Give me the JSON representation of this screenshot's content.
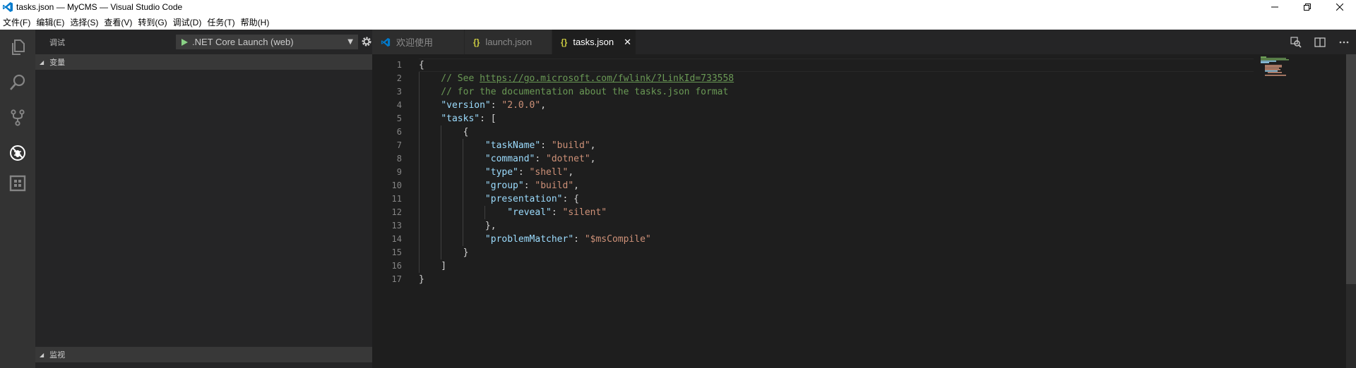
{
  "window": {
    "title": "tasks.json — MyCMS — Visual Studio Code"
  },
  "menu": [
    "文件(F)",
    "编辑(E)",
    "选择(S)",
    "查看(V)",
    "转到(G)",
    "调试(D)",
    "任务(T)",
    "帮助(H)"
  ],
  "sidebar": {
    "title": "调试",
    "launch_config": ".NET Core Launch (web)",
    "sections": {
      "variables": "变量",
      "watch": "监视"
    }
  },
  "tabs": [
    {
      "label": "欢迎使用",
      "icon": "vscode-logo-icon",
      "active": false
    },
    {
      "label": "launch.json",
      "icon": "json-braces-icon",
      "active": false
    },
    {
      "label": "tasks.json",
      "icon": "json-braces-icon",
      "active": true
    }
  ],
  "editor": {
    "line_numbers": [
      "1",
      "2",
      "3",
      "4",
      "5",
      "6",
      "7",
      "8",
      "9",
      "10",
      "11",
      "12",
      "13",
      "14",
      "15",
      "16",
      "17"
    ],
    "lines": [
      [
        {
          "t": "{",
          "c": "p"
        }
      ],
      [
        {
          "t": "    // See ",
          "c": "c"
        },
        {
          "t": "https://go.microsoft.com/fwlink/?LinkId=733558",
          "c": "u"
        }
      ],
      [
        {
          "t": "    // for the documentation about the tasks.json format",
          "c": "c"
        }
      ],
      [
        {
          "t": "    ",
          "c": "p"
        },
        {
          "t": "\"version\"",
          "c": "k"
        },
        {
          "t": ": ",
          "c": "p"
        },
        {
          "t": "\"2.0.0\"",
          "c": "s"
        },
        {
          "t": ",",
          "c": "p"
        }
      ],
      [
        {
          "t": "    ",
          "c": "p"
        },
        {
          "t": "\"tasks\"",
          "c": "k"
        },
        {
          "t": ": [",
          "c": "p"
        }
      ],
      [
        {
          "t": "        {",
          "c": "p"
        }
      ],
      [
        {
          "t": "            ",
          "c": "p"
        },
        {
          "t": "\"taskName\"",
          "c": "k"
        },
        {
          "t": ": ",
          "c": "p"
        },
        {
          "t": "\"build\"",
          "c": "s"
        },
        {
          "t": ",",
          "c": "p"
        }
      ],
      [
        {
          "t": "            ",
          "c": "p"
        },
        {
          "t": "\"command\"",
          "c": "k"
        },
        {
          "t": ": ",
          "c": "p"
        },
        {
          "t": "\"dotnet\"",
          "c": "s"
        },
        {
          "t": ",",
          "c": "p"
        }
      ],
      [
        {
          "t": "            ",
          "c": "p"
        },
        {
          "t": "\"type\"",
          "c": "k"
        },
        {
          "t": ": ",
          "c": "p"
        },
        {
          "t": "\"shell\"",
          "c": "s"
        },
        {
          "t": ",",
          "c": "p"
        }
      ],
      [
        {
          "t": "            ",
          "c": "p"
        },
        {
          "t": "\"group\"",
          "c": "k"
        },
        {
          "t": ": ",
          "c": "p"
        },
        {
          "t": "\"build\"",
          "c": "s"
        },
        {
          "t": ",",
          "c": "p"
        }
      ],
      [
        {
          "t": "            ",
          "c": "p"
        },
        {
          "t": "\"presentation\"",
          "c": "k"
        },
        {
          "t": ": {",
          "c": "p"
        }
      ],
      [
        {
          "t": "                ",
          "c": "p"
        },
        {
          "t": "\"reveal\"",
          "c": "k"
        },
        {
          "t": ": ",
          "c": "p"
        },
        {
          "t": "\"silent\"",
          "c": "s"
        }
      ],
      [
        {
          "t": "            },",
          "c": "p"
        }
      ],
      [
        {
          "t": "            ",
          "c": "p"
        },
        {
          "t": "\"problemMatcher\"",
          "c": "k"
        },
        {
          "t": ": ",
          "c": "p"
        },
        {
          "t": "\"$msCompile\"",
          "c": "s"
        }
      ],
      [
        {
          "t": "        }",
          "c": "p"
        }
      ],
      [
        {
          "t": "    ]",
          "c": "p"
        }
      ],
      [
        {
          "t": "}",
          "c": "p"
        }
      ]
    ]
  },
  "colors": {
    "editor_bg": "#1e1e1e",
    "sidebar_bg": "#252526",
    "activitybar_bg": "#333333",
    "key": "#9cdcfe",
    "string": "#ce9178",
    "comment": "#6a9955",
    "json_icon": "#cbcb41",
    "vscode_blue": "#007acc"
  }
}
